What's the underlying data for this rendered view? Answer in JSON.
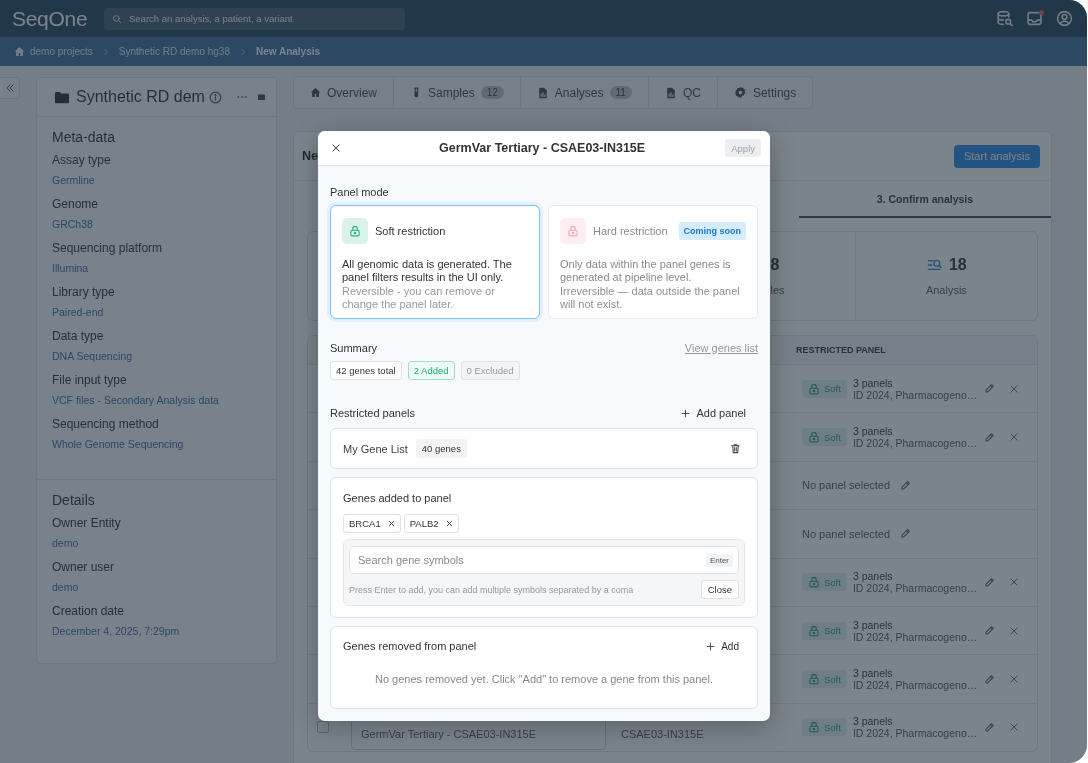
{
  "header": {
    "logo": "SeqOne",
    "search": {
      "placeholder": "Search an analysis, a patient, a variant"
    },
    "notifications": {
      "unread": true
    }
  },
  "breadcrumb": [
    {
      "label": "demo projects",
      "kind": "home"
    },
    {
      "label": "Synthetic RD demo hg38",
      "kind": "link"
    },
    {
      "label": "New Analysis",
      "kind": "current"
    }
  ],
  "project": {
    "title": "Synthetic RD dem",
    "sections": [
      {
        "heading": "Meta-data",
        "fields": [
          {
            "label": "Assay type",
            "value": "Germline"
          },
          {
            "label": "Genome",
            "value": "GRCh38"
          },
          {
            "label": "Sequencing platform",
            "value": "Illumina"
          },
          {
            "label": "Library type",
            "value": "Paired-end"
          },
          {
            "label": "Data type",
            "value": "DNA Sequencing"
          },
          {
            "label": "File input type",
            "value": "VCF files - Secondary Analysis data"
          },
          {
            "label": "Sequencing method",
            "value": "Whole Genome Sequencing"
          }
        ]
      },
      {
        "heading": "Details",
        "fields": [
          {
            "label": "Owner Entity",
            "value": "demo"
          },
          {
            "label": "Owner user",
            "value": "demo"
          },
          {
            "label": "Creation date",
            "value": "December 4, 2025, 7:29pm"
          }
        ]
      }
    ]
  },
  "tabs": [
    {
      "label": "Overview",
      "selected": false
    },
    {
      "label": "Samples",
      "count": "12",
      "selected": false
    },
    {
      "label": "Analyses",
      "count": "11",
      "selected": false
    },
    {
      "label": "QC",
      "selected": false
    },
    {
      "label": "Settings",
      "selected": false
    }
  ],
  "analysis": {
    "title": "Ne",
    "start_button": "Start analysis",
    "step": "3. Confirm analysis",
    "stats": [
      {
        "kind": "samples",
        "value": "8",
        "label": "les"
      },
      {
        "kind": "analysis",
        "value": "18",
        "label": "Analysis"
      }
    ],
    "table": {
      "columns": [
        {
          "label": "RESTRICTED PANEL"
        }
      ],
      "rows": [
        {
          "kind": "panels",
          "mode": "Soft",
          "count": "3 panels",
          "names": "ID 2024, Pharmacogeno…"
        },
        {
          "kind": "panels",
          "mode": "Soft",
          "count": "3 panels",
          "names": "ID 2024, Pharmacogeno…"
        },
        {
          "kind": "none",
          "text": "No panel selected"
        },
        {
          "kind": "none",
          "text": "No panel selected"
        },
        {
          "kind": "panels",
          "mode": "Soft",
          "count": "3 panels",
          "names": "ID 2024, Pharmacogeno…"
        },
        {
          "kind": "panels",
          "mode": "Soft",
          "count": "3 panels",
          "names": "ID 2024, Pharmacogeno…"
        },
        {
          "kind": "panels",
          "mode": "Soft",
          "count": "3 panels",
          "names": "ID 2024, Pharmacogeno…"
        },
        {
          "kind": "panels",
          "mode": "Soft",
          "count": "3 panels",
          "names": "ID 2024, Pharmacogeno…",
          "checked": false,
          "name": "GermVar Tertiary - CSAE03-IN315E",
          "sample": "CSAE03-IN315E"
        }
      ]
    }
  },
  "modal": {
    "title": "GermVar Tertiary - CSAE03-IN315E",
    "apply_button": {
      "label": "Apply",
      "disabled": true
    },
    "panel_mode": {
      "label": "Panel mode",
      "options": [
        {
          "kind": "soft",
          "title": "Soft restriction",
          "description": "All genomic data is generated. The panel filters results in the UI only.",
          "note": "Reversible - you can remove or change the panel later.",
          "selected": true,
          "disabled": false
        },
        {
          "kind": "hard",
          "title": "Hard restriction",
          "badge": "Coming soon",
          "description": "Only data within the panel genes is generated at pipeline level.",
          "note": "Irreversible — data outside the panel will not exist.",
          "selected": false,
          "disabled": true
        }
      ]
    },
    "summary": {
      "label": "Summary",
      "link": "View genes list",
      "chips": [
        {
          "kind": "total",
          "label": "42 genes total"
        },
        {
          "kind": "added",
          "label": "2 Added"
        },
        {
          "kind": "excluded",
          "label": "0 Excluded"
        }
      ]
    },
    "restricted_panels": {
      "label": "Restricted panels",
      "add_button": "Add panel",
      "panels": [
        {
          "name": "My Gene List",
          "count": "40 genes"
        }
      ]
    },
    "genes_added": {
      "title": "Genes added to panel",
      "genes": [
        "BRCA1",
        "PALB2"
      ],
      "search": {
        "placeholder": "Search gene symbols",
        "key_hint": "Enter"
      },
      "hint": "Press Enter to add, you can add multiple symbols separated by a coma",
      "close_button": "Close"
    },
    "genes_removed": {
      "title": "Genes removed from panel",
      "add_button": "Add",
      "empty_text": "No genes removed yet. Click \"Add\" to remove a gene from this panel."
    }
  }
}
